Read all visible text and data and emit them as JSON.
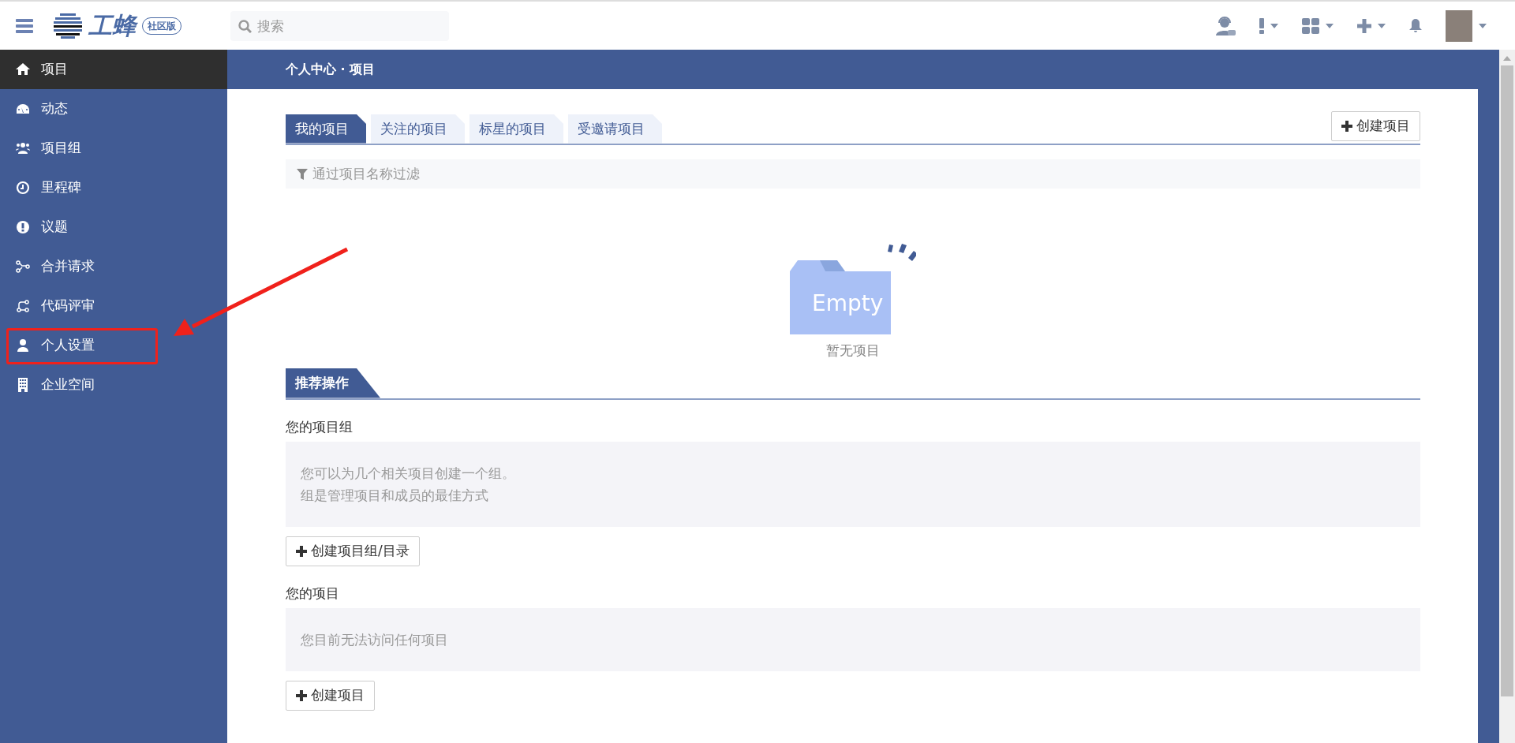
{
  "topbar": {
    "logo_text": "工蜂",
    "edition_badge": "社区版",
    "search": {
      "placeholder": "搜索"
    }
  },
  "sidebar": {
    "items": [
      {
        "label": "项目",
        "selected": true,
        "highlighted": false
      },
      {
        "label": "动态",
        "selected": false,
        "highlighted": false
      },
      {
        "label": "项目组",
        "selected": false,
        "highlighted": false
      },
      {
        "label": "里程碑",
        "selected": false,
        "highlighted": false
      },
      {
        "label": "议题",
        "selected": false,
        "highlighted": false
      },
      {
        "label": "合并请求",
        "selected": false,
        "highlighted": false
      },
      {
        "label": "代码评审",
        "selected": false,
        "highlighted": false
      },
      {
        "label": "个人设置",
        "selected": false,
        "highlighted": true
      },
      {
        "label": "企业空间",
        "selected": false,
        "highlighted": false
      }
    ]
  },
  "page_header": {
    "title": "个人中心 · 项目"
  },
  "tabs": [
    {
      "label": "我的项目",
      "selected": true
    },
    {
      "label": "关注的项目",
      "selected": false
    },
    {
      "label": "标星的项目",
      "selected": false
    },
    {
      "label": "受邀请项目",
      "selected": false
    }
  ],
  "create_button": "创建项目",
  "filter": {
    "placeholder": "通过项目名称过滤"
  },
  "empty_state": {
    "image_text": "Empty",
    "message": "暂无项目"
  },
  "recommended": {
    "title": "推荐操作",
    "sections": [
      {
        "heading": "您的项目组",
        "lines": [
          "您可以为几个相关项目创建一个组。",
          "组是管理项目和成员的最佳方式"
        ],
        "button": "创建项目组/目录"
      },
      {
        "heading": "您的项目",
        "lines": [
          "您目前无法访问任何项目"
        ],
        "button": "创建项目"
      }
    ]
  }
}
